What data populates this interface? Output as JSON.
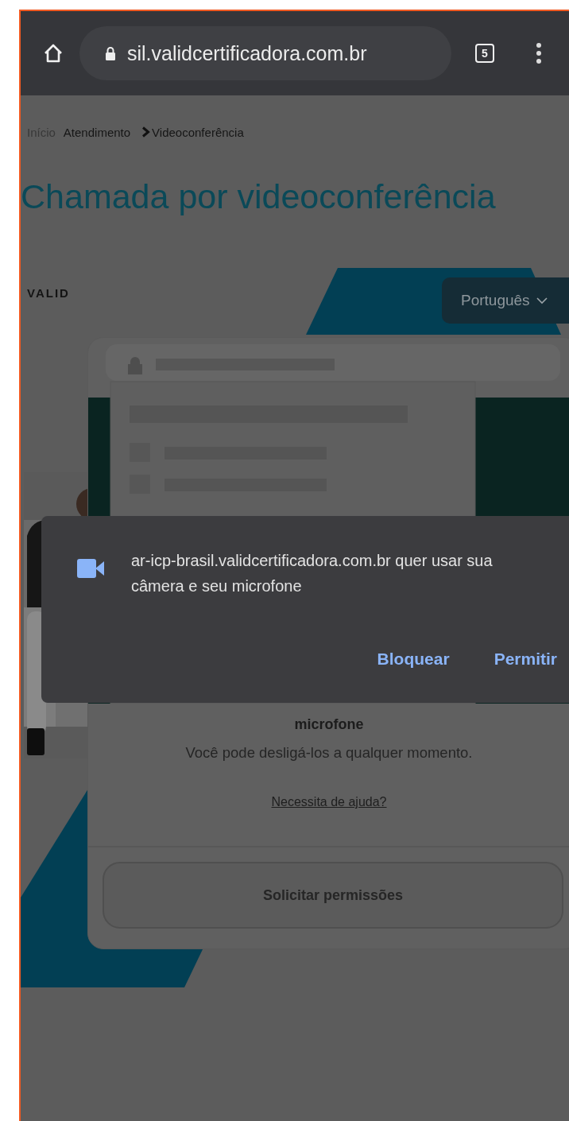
{
  "browser": {
    "url": "sil.validcertificadora.com.br",
    "tab_count": "5"
  },
  "breadcrumb": [
    {
      "label": "Início",
      "muted": true
    },
    {
      "label": "Atendimento",
      "muted": false
    },
    {
      "label": "Videoconferência",
      "muted": false
    }
  ],
  "title": "Chamada por videoconferência",
  "logo": "VALID",
  "language": {
    "label": "Português"
  },
  "permission_prompt": {
    "message": "ar-icp-brasil.validcertificadora.com.br quer usar sua câmera e seu microfone",
    "buttons": [
      {
        "label": "Bloquear"
      },
      {
        "label": "Permitir"
      }
    ]
  },
  "card": {
    "emphasis": "microfone",
    "note": "Você pode desligá-los a qualquer momento.",
    "help_link": "Necessita de ajuda?",
    "button": {
      "label": "Solicitar permissões",
      "disabled": true
    }
  }
}
